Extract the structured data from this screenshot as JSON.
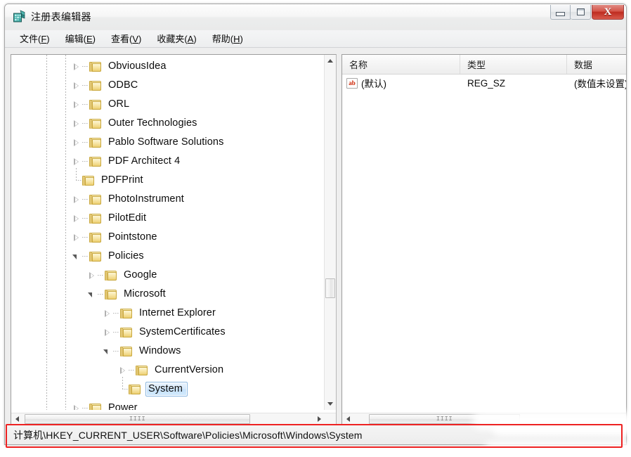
{
  "window": {
    "title": "注册表编辑器",
    "icon": "registry-editor-icon",
    "controls": {
      "minimize": "minimize-button",
      "maximize": "maximize-button",
      "close_label": "X"
    }
  },
  "menubar": {
    "items": [
      {
        "label": "文件(F)",
        "text": "文件(",
        "accel": "F",
        "tail": ")"
      },
      {
        "label": "编辑(E)",
        "text": "编辑(",
        "accel": "E",
        "tail": ")"
      },
      {
        "label": "查看(V)",
        "text": "查看(",
        "accel": "V",
        "tail": ")"
      },
      {
        "label": "收藏夹(A)",
        "text": "收藏夹(",
        "accel": "A",
        "tail": ")"
      },
      {
        "label": "帮助(H)",
        "text": "帮助(",
        "accel": "H",
        "tail": ")"
      }
    ]
  },
  "tree": {
    "nodes": [
      {
        "label": "ObviousIdea",
        "depth": 0,
        "state": "collapsed"
      },
      {
        "label": "ODBC",
        "depth": 0,
        "state": "collapsed"
      },
      {
        "label": "ORL",
        "depth": 0,
        "state": "collapsed"
      },
      {
        "label": "Outer Technologies",
        "depth": 0,
        "state": "collapsed"
      },
      {
        "label": "Pablo Software Solutions",
        "depth": 0,
        "state": "collapsed"
      },
      {
        "label": "PDF Architect 4",
        "depth": 0,
        "state": "collapsed"
      },
      {
        "label": "PDFPrint",
        "depth": 0,
        "state": "leaf"
      },
      {
        "label": "PhotoInstrument",
        "depth": 0,
        "state": "collapsed"
      },
      {
        "label": "PilotEdit",
        "depth": 0,
        "state": "collapsed"
      },
      {
        "label": "Pointstone",
        "depth": 0,
        "state": "collapsed"
      },
      {
        "label": "Policies",
        "depth": 0,
        "state": "expanded"
      },
      {
        "label": "Google",
        "depth": 1,
        "state": "collapsed"
      },
      {
        "label": "Microsoft",
        "depth": 1,
        "state": "expanded"
      },
      {
        "label": "Internet Explorer",
        "depth": 2,
        "state": "collapsed"
      },
      {
        "label": "SystemCertificates",
        "depth": 2,
        "state": "collapsed"
      },
      {
        "label": "Windows",
        "depth": 2,
        "state": "expanded"
      },
      {
        "label": "CurrentVersion",
        "depth": 3,
        "state": "collapsed"
      },
      {
        "label": "System",
        "depth": 3,
        "state": "leaf",
        "selected": true
      },
      {
        "label": "Power",
        "depth": 0,
        "state": "collapsed"
      }
    ],
    "scrollbars": {
      "horizontal_grip": "IIII",
      "vertical_up": "scroll-up-arrow",
      "vertical_down": "scroll-down-arrow"
    }
  },
  "values": {
    "columns": [
      {
        "header": "名称"
      },
      {
        "header": "类型"
      },
      {
        "header": "数据"
      }
    ],
    "rows": [
      {
        "icon": "string-value-icon",
        "icon_text": "ab",
        "name": "(默认)",
        "type": "REG_SZ",
        "data": "(数值未设置)"
      }
    ],
    "scrollbars": {
      "horizontal_grip": "IIII"
    }
  },
  "statusbar": {
    "path": "计算机\\HKEY_CURRENT_USER\\Software\\Policies\\Microsoft\\Windows\\System"
  },
  "annotation": {
    "highlight_color": "#ee2222",
    "target": "statusbar-path"
  },
  "colors": {
    "selection_border": "#8bb7e0",
    "selection_fill": "#c5e1fa",
    "close_button": "#bf2c20",
    "folder_yellow": "#f3dc8e",
    "string_icon_red": "#cc2200"
  }
}
